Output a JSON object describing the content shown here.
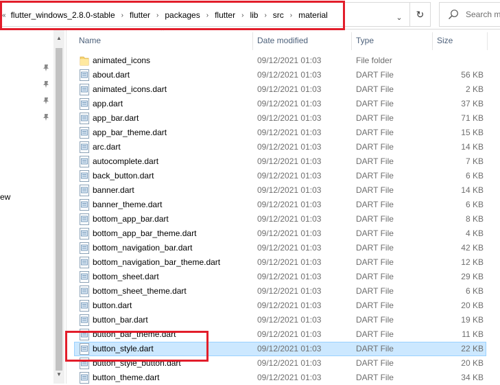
{
  "address": {
    "overflow_glyph": "«",
    "separator_glyph": "›",
    "crumbs": [
      "flutter_windows_2.8.0-stable",
      "flutter",
      "packages",
      "flutter",
      "lib",
      "src",
      "material"
    ],
    "dropdown_glyph": "⌄",
    "refresh_glyph": "↻"
  },
  "search": {
    "placeholder": "Search m"
  },
  "nav": {
    "partial_label": "ew"
  },
  "columns": {
    "name": "Name",
    "date": "Date modified",
    "type": "Type",
    "size": "Size"
  },
  "files": [
    {
      "name": "animated_icons",
      "date": "09/12/2021 01:03",
      "type": "File folder",
      "size": "",
      "kind": "folder"
    },
    {
      "name": "about.dart",
      "date": "09/12/2021 01:03",
      "type": "DART File",
      "size": "56 KB",
      "kind": "file"
    },
    {
      "name": "animated_icons.dart",
      "date": "09/12/2021 01:03",
      "type": "DART File",
      "size": "2 KB",
      "kind": "file"
    },
    {
      "name": "app.dart",
      "date": "09/12/2021 01:03",
      "type": "DART File",
      "size": "37 KB",
      "kind": "file"
    },
    {
      "name": "app_bar.dart",
      "date": "09/12/2021 01:03",
      "type": "DART File",
      "size": "71 KB",
      "kind": "file"
    },
    {
      "name": "app_bar_theme.dart",
      "date": "09/12/2021 01:03",
      "type": "DART File",
      "size": "15 KB",
      "kind": "file"
    },
    {
      "name": "arc.dart",
      "date": "09/12/2021 01:03",
      "type": "DART File",
      "size": "14 KB",
      "kind": "file"
    },
    {
      "name": "autocomplete.dart",
      "date": "09/12/2021 01:03",
      "type": "DART File",
      "size": "7 KB",
      "kind": "file"
    },
    {
      "name": "back_button.dart",
      "date": "09/12/2021 01:03",
      "type": "DART File",
      "size": "6 KB",
      "kind": "file"
    },
    {
      "name": "banner.dart",
      "date": "09/12/2021 01:03",
      "type": "DART File",
      "size": "14 KB",
      "kind": "file"
    },
    {
      "name": "banner_theme.dart",
      "date": "09/12/2021 01:03",
      "type": "DART File",
      "size": "6 KB",
      "kind": "file"
    },
    {
      "name": "bottom_app_bar.dart",
      "date": "09/12/2021 01:03",
      "type": "DART File",
      "size": "8 KB",
      "kind": "file"
    },
    {
      "name": "bottom_app_bar_theme.dart",
      "date": "09/12/2021 01:03",
      "type": "DART File",
      "size": "4 KB",
      "kind": "file"
    },
    {
      "name": "bottom_navigation_bar.dart",
      "date": "09/12/2021 01:03",
      "type": "DART File",
      "size": "42 KB",
      "kind": "file"
    },
    {
      "name": "bottom_navigation_bar_theme.dart",
      "date": "09/12/2021 01:03",
      "type": "DART File",
      "size": "12 KB",
      "kind": "file"
    },
    {
      "name": "bottom_sheet.dart",
      "date": "09/12/2021 01:03",
      "type": "DART File",
      "size": "29 KB",
      "kind": "file"
    },
    {
      "name": "bottom_sheet_theme.dart",
      "date": "09/12/2021 01:03",
      "type": "DART File",
      "size": "6 KB",
      "kind": "file"
    },
    {
      "name": "button.dart",
      "date": "09/12/2021 01:03",
      "type": "DART File",
      "size": "20 KB",
      "kind": "file"
    },
    {
      "name": "button_bar.dart",
      "date": "09/12/2021 01:03",
      "type": "DART File",
      "size": "19 KB",
      "kind": "file"
    },
    {
      "name": "button_bar_theme.dart",
      "date": "09/12/2021 01:03",
      "type": "DART File",
      "size": "11 KB",
      "kind": "file"
    },
    {
      "name": "button_style.dart",
      "date": "09/12/2021 01:03",
      "type": "DART File",
      "size": "22 KB",
      "kind": "file",
      "selected": true
    },
    {
      "name": "button_style_button.dart",
      "date": "09/12/2021 01:03",
      "type": "DART File",
      "size": "20 KB",
      "kind": "file"
    },
    {
      "name": "button_theme.dart",
      "date": "09/12/2021 01:03",
      "type": "DART File",
      "size": "34 KB",
      "kind": "file"
    }
  ],
  "colors": {
    "highlight": "#e21d2a",
    "selection": "#cce8ff",
    "header_text": "#4c607a"
  }
}
